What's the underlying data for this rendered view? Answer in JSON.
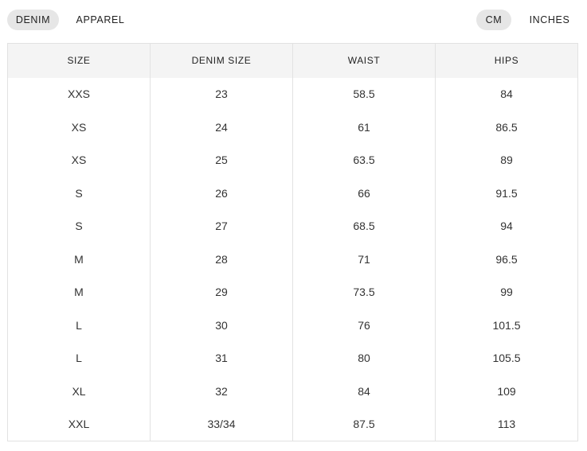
{
  "category_tabs": [
    {
      "label": "DENIM",
      "active": true
    },
    {
      "label": "APPAREL",
      "active": false
    }
  ],
  "unit_tabs": [
    {
      "label": "CM",
      "active": true
    },
    {
      "label": "INCHES",
      "active": false
    }
  ],
  "table": {
    "headers": [
      "SIZE",
      "DENIM SIZE",
      "WAIST",
      "HIPS"
    ],
    "rows": [
      [
        "XXS",
        "23",
        "58.5",
        "84"
      ],
      [
        "XS",
        "24",
        "61",
        "86.5"
      ],
      [
        "XS",
        "25",
        "63.5",
        "89"
      ],
      [
        "S",
        "26",
        "66",
        "91.5"
      ],
      [
        "S",
        "27",
        "68.5",
        "94"
      ],
      [
        "M",
        "28",
        "71",
        "96.5"
      ],
      [
        "M",
        "29",
        "73.5",
        "99"
      ],
      [
        "L",
        "30",
        "76",
        "101.5"
      ],
      [
        "L",
        "31",
        "80",
        "105.5"
      ],
      [
        "XL",
        "32",
        "84",
        "109"
      ],
      [
        "XXL",
        "33/34",
        "87.5",
        "113"
      ]
    ]
  },
  "colors": {
    "active_pill_bg": "#e6e6e6",
    "header_bg": "#f4f4f4",
    "border": "#e2e2e2",
    "text": "#222222"
  }
}
